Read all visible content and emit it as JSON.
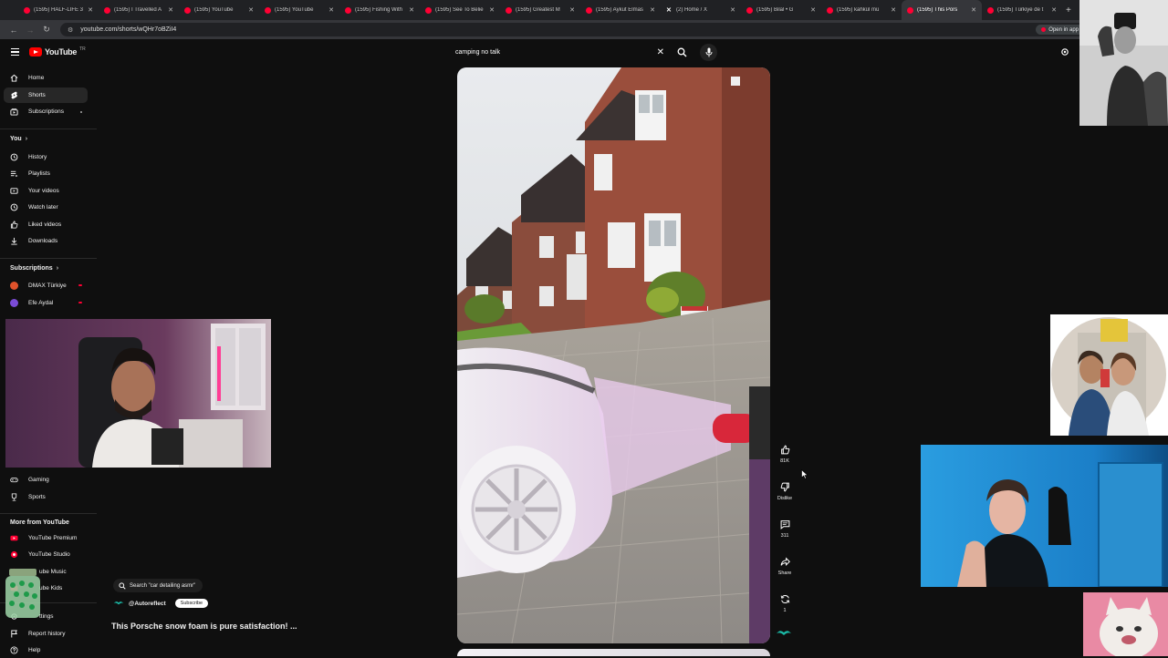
{
  "browser": {
    "tabs": [
      {
        "label": "(1595) HALF-LIFE 3",
        "icon": "youtube-icon"
      },
      {
        "label": "(1595) I Travelled A",
        "icon": "youtube-icon"
      },
      {
        "label": "(1595) YouTube",
        "icon": "youtube-icon"
      },
      {
        "label": "(1595) YouTube",
        "icon": "youtube-icon"
      },
      {
        "label": "(1595) Fishing With",
        "icon": "youtube-icon"
      },
      {
        "label": "(1595) See To Belie",
        "icon": "youtube-icon"
      },
      {
        "label": "(1595) Greatest M",
        "icon": "youtube-icon"
      },
      {
        "label": "(1595) Aykut Elmas",
        "icon": "youtube-icon"
      },
      {
        "label": "(2) Home / X",
        "icon": "x-icon"
      },
      {
        "label": "(1595) Bilal • G",
        "icon": "youtube-icon"
      },
      {
        "label": "(1595) kahkül mü",
        "icon": "youtube-icon"
      },
      {
        "label": "(1595) This Pors",
        "icon": "youtube-icon",
        "active": true
      },
      {
        "label": "(1595) Türkiye de t",
        "icon": "youtube-icon"
      }
    ],
    "url": "youtube.com/shorts/wQHr7oBZiI4",
    "open_in_app": "Open in app"
  },
  "header": {
    "logo_text": "YouTube",
    "logo_country": "TR",
    "search_value": "camping no talk"
  },
  "sidebar": {
    "main": [
      {
        "label": "Home",
        "icon": "home-icon"
      },
      {
        "label": "Shorts",
        "icon": "shorts-icon",
        "active": true
      },
      {
        "label": "Subscriptions",
        "icon": "subscriptions-icon"
      }
    ],
    "you_heading": "You",
    "you": [
      {
        "label": "History",
        "icon": "history-icon"
      },
      {
        "label": "Playlists",
        "icon": "playlists-icon"
      },
      {
        "label": "Your videos",
        "icon": "your-videos-icon"
      },
      {
        "label": "Watch later",
        "icon": "watch-later-icon"
      },
      {
        "label": "Liked videos",
        "icon": "liked-videos-icon"
      },
      {
        "label": "Downloads",
        "icon": "downloads-icon"
      }
    ],
    "subs_heading": "Subscriptions",
    "subs": [
      {
        "label": "DMAX Türkiye",
        "color": "#e0522b"
      },
      {
        "label": "Efe Aydal",
        "color": "#7a4bd6"
      }
    ],
    "explore": [
      {
        "label": "Gaming",
        "icon": "gaming-icon"
      },
      {
        "label": "Sports",
        "icon": "sports-icon"
      }
    ],
    "more_heading": "More from YouTube",
    "more": [
      {
        "label": "YouTube Premium",
        "icon": "youtube-premium-icon"
      },
      {
        "label": "YouTube Studio",
        "icon": "youtube-studio-icon"
      },
      {
        "label": "ube Music",
        "icon": "youtube-music-icon"
      },
      {
        "label": "ube Kids",
        "icon": "youtube-kids-icon"
      }
    ],
    "bottom": [
      {
        "label": "ttings",
        "icon": "settings-icon"
      },
      {
        "label": "Report history",
        "icon": "report-icon"
      },
      {
        "label": "Help",
        "icon": "help-icon"
      }
    ]
  },
  "short": {
    "search_suggestion": "Search \"car detailing asmr\"",
    "channel": "@Autoreflect",
    "subscribe_label": "Subscribe",
    "title": "This Porsche snow foam is pure satisfaction! ...",
    "actions": {
      "like_count": "81K",
      "dislike_label": "Dislike",
      "comment_count": "311",
      "share_label": "Share",
      "remix_count": "1"
    }
  }
}
